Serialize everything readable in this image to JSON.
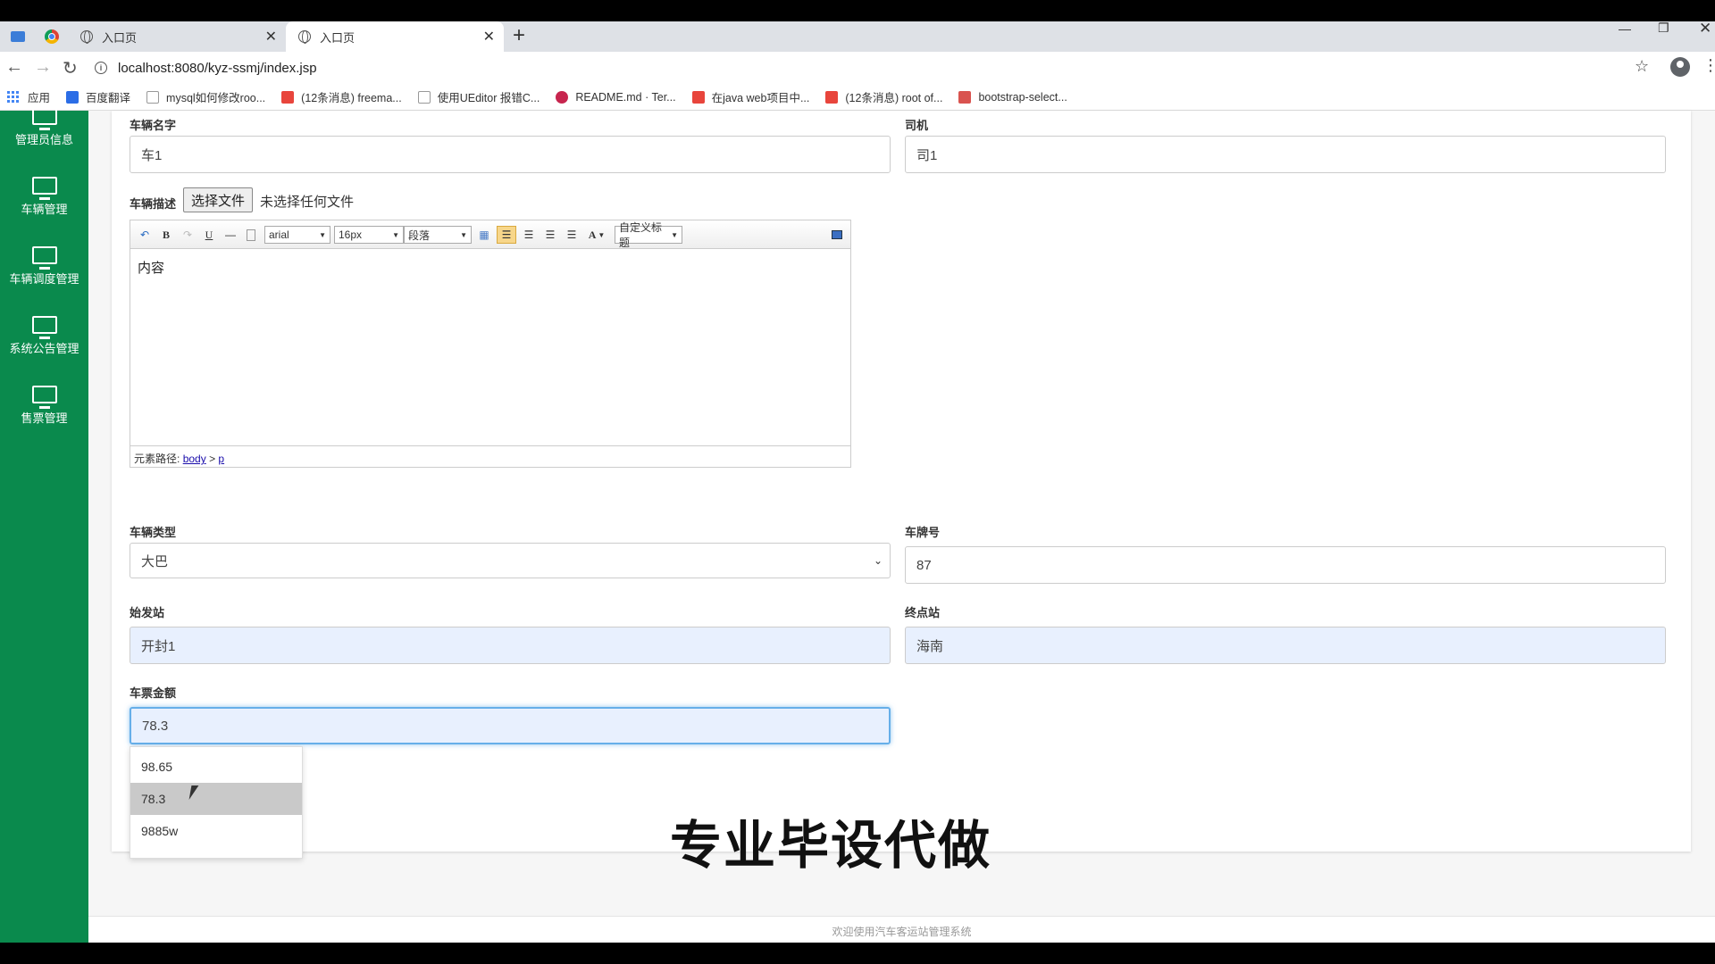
{
  "browser": {
    "tabs": [
      {
        "title": "入口页"
      },
      {
        "title": "入口页"
      }
    ],
    "url": "localhost:8080/kyz-ssmj/index.jsp",
    "bookmarks": [
      {
        "label": "应用",
        "color": "#4285f4"
      },
      {
        "label": "百度翻译",
        "color": "#2b6de6"
      },
      {
        "label": "mysql如何修改roo...",
        "color": "#666666"
      },
      {
        "label": "(12条消息) freema...",
        "color": "#e8453c"
      },
      {
        "label": "使用UEditor 报错C...",
        "color": "#666666"
      },
      {
        "label": "README.md · Ter...",
        "color": "#c7254e"
      },
      {
        "label": "在java web项目中...",
        "color": "#e8453c"
      },
      {
        "label": "(12条消息) root of...",
        "color": "#e8453c"
      },
      {
        "label": "bootstrap-select...",
        "color": "#d9534f"
      }
    ]
  },
  "sidebar": {
    "items": [
      {
        "label": "管理员信息"
      },
      {
        "label": "车辆管理"
      },
      {
        "label": "车辆调度管理"
      },
      {
        "label": "系统公告管理"
      },
      {
        "label": "售票管理"
      }
    ],
    "bg_color": "#0a8a4d"
  },
  "form": {
    "vehicle_name": {
      "label": "车辆名字",
      "value": "车1"
    },
    "driver": {
      "label": "司机",
      "value": "司1"
    },
    "description": {
      "label": "车辆描述",
      "file_button": "选择文件",
      "file_status": "未选择任何文件",
      "editor": {
        "font": "arial",
        "size": "16px",
        "paragraph": "段落",
        "custom_title": "自定义标题",
        "content": "内容",
        "path_label": "元素路径:",
        "path_body": "body",
        "path_sep": ">",
        "path_p": "p"
      }
    },
    "vehicle_type": {
      "label": "车辆类型",
      "value": "大巴"
    },
    "plate": {
      "label": "车牌号",
      "value": "87"
    },
    "start_station": {
      "label": "始发站",
      "value": "开封1"
    },
    "end_station": {
      "label": "终点站",
      "value": "海南"
    },
    "ticket_price": {
      "label": "车票金额",
      "value": "78.3"
    },
    "autocomplete": [
      "98.65",
      "78.3",
      "9885w"
    ]
  },
  "footer": {
    "text": "欢迎使用汽车客运站管理系统"
  },
  "watermark": "专业毕设代做"
}
